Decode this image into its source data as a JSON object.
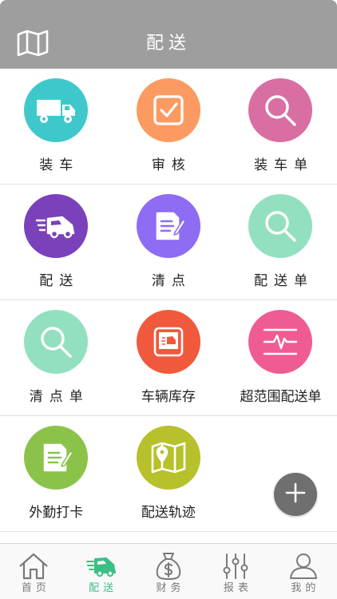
{
  "header": {
    "title": "配送",
    "map_icon": "map-icon"
  },
  "grid": [
    {
      "label": "装车",
      "icon": "truck-icon",
      "color": "#3fc8cc"
    },
    {
      "label": "审核",
      "icon": "checkbox-icon",
      "color": "#fb9b61"
    },
    {
      "label": "装车单",
      "icon": "search-icon",
      "color": "#d96ea3"
    },
    {
      "label": "配送",
      "icon": "delivery-van-icon",
      "color": "#7b41ba"
    },
    {
      "label": "清点",
      "icon": "edit-document-icon",
      "color": "#8e6cf4"
    },
    {
      "label": "配送单",
      "icon": "search-icon",
      "color": "#93e0c0"
    },
    {
      "label": "清点单",
      "icon": "search-icon",
      "color": "#93e0c0"
    },
    {
      "label": "车辆库存",
      "icon": "vehicle-stock-icon",
      "color": "#f1593c"
    },
    {
      "label": "超范围配送单",
      "icon": "pulse-line-icon",
      "color": "#ef5c93"
    },
    {
      "label": "外勤打卡",
      "icon": "edit-document-icon",
      "color": "#8bc34a"
    },
    {
      "label": "配送轨迹",
      "icon": "map-pin-icon",
      "color": "#b6c12c"
    }
  ],
  "fab": {
    "icon": "plus-icon"
  },
  "bottom_nav": [
    {
      "label": "首页",
      "icon": "home-icon",
      "active": false
    },
    {
      "label": "配送",
      "icon": "delivery-van-icon",
      "active": true
    },
    {
      "label": "财务",
      "icon": "money-bag-icon",
      "active": false
    },
    {
      "label": "报表",
      "icon": "sliders-icon",
      "active": false
    },
    {
      "label": "我的",
      "icon": "user-icon",
      "active": false
    }
  ],
  "colors": {
    "header_bg": "#9e9e9e",
    "active": "#3cbf84",
    "inactive": "#7a7a7a"
  }
}
